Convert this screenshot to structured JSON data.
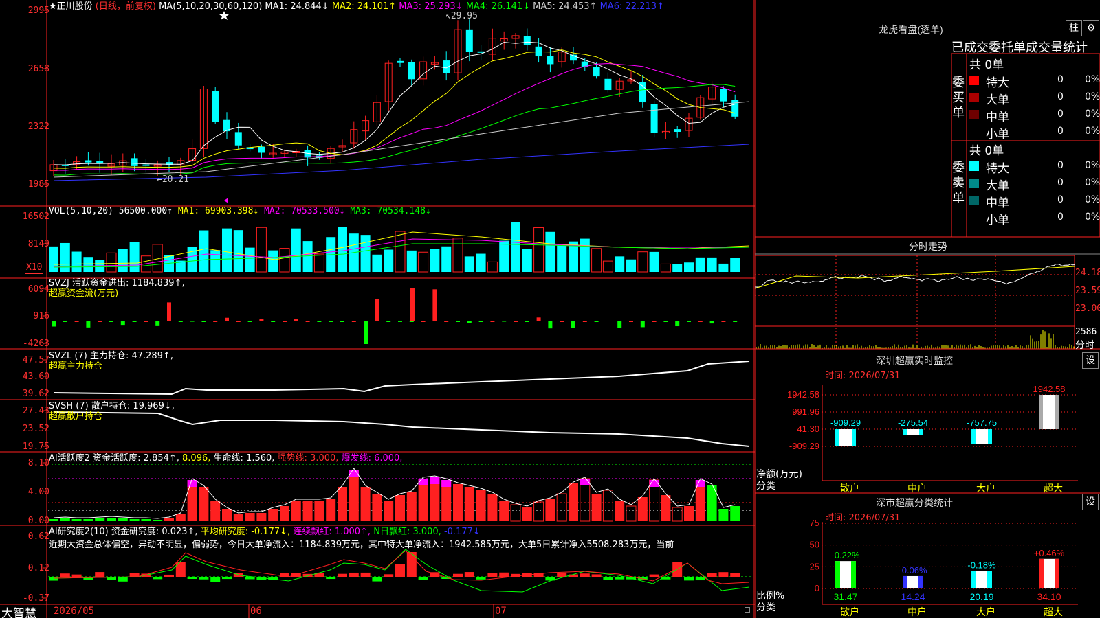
{
  "main": {
    "stock_name": "★正川股份",
    "period": "(日线，前复权)",
    "ma_params": "MA(5,10,20,30,60,120)",
    "ma": [
      {
        "label": "MA1:",
        "value": "24.844↓",
        "color": "#ffffff"
      },
      {
        "label": "MA2:",
        "value": "24.101↑",
        "color": "#ffff00"
      },
      {
        "label": "MA3:",
        "value": "25.293↓",
        "color": "#ff00ff"
      },
      {
        "label": "MA4:",
        "value": "26.141↓",
        "color": "#00ff00"
      },
      {
        "label": "MA5:",
        "value": "24.453↑",
        "color": "#cccccc"
      },
      {
        "label": "MA6:",
        "value": "22.213↑",
        "color": "#3333ff"
      }
    ],
    "axis": [
      "2995",
      "2658",
      "2322",
      "1985"
    ],
    "high_label": "29.95",
    "low_label": "20.21"
  },
  "vol": {
    "header": "VOL(5,10,20)",
    "value": "56500.000↑",
    "ma1": "MA1: 69903.398↓",
    "ma2": "MA2: 70533.500↓",
    "ma3": "MA3: 70534.148↓",
    "axis": [
      "16502",
      "8149"
    ],
    "unit": "X10"
  },
  "svzj": {
    "header": "SVZJ  活跃资金进出: 1184.839↑,",
    "sub": "超赢资金流(万元)",
    "axis": [
      "6094",
      "916",
      "-4263"
    ]
  },
  "svzl": {
    "header": "SVZL (7) 主力持仓: 47.289↑,",
    "sub": "超赢主力持仓",
    "axis": [
      "47.57",
      "43.60",
      "39.62"
    ]
  },
  "svsh": {
    "header": "SVSH (7) 散户持仓: 19.969↓,",
    "sub": "超赢散户持仓",
    "axis": [
      "27.43",
      "23.52",
      "19.75"
    ]
  },
  "ai_active": {
    "header_a": "AI活跃度2 资金活跃度: 2.854↑,",
    "header_b": "8.096,",
    "header_c": "生命线: 1.560,",
    "header_d": "强势线: 3.000,",
    "header_e": "爆发线: 6.000,",
    "axis": [
      "8.10",
      "4.00",
      "0.00"
    ]
  },
  "ai_research": {
    "header_a": "AI研究度2(10) 资金研究度: 0.023↑,",
    "header_b": "平均研究度: -0.177↓,",
    "header_c": "连续飘红: 1.000↑,",
    "header_d": "N日飘红: 3.000,",
    "header_e": "-0.177↓",
    "summary": "近期大资金总体偏空，异动不明显，偏弱势，今日大单净流入：1184.839万元，其中特大单净流入：1942.585万元，大单5日累计净入5508.283万元，当前",
    "axis": [
      "0.62",
      "0.12",
      "-0.37"
    ]
  },
  "dates": [
    "2026/05",
    "06",
    "07"
  ],
  "brand": "大智慧",
  "longhu": {
    "title": "龙虎看盘(逐单)",
    "btn_zhu": "柱",
    "btn_gear": "⚙",
    "tabs": "已成交委托单成交量统计",
    "buy_label": "委买单",
    "sell_label": "委卖单",
    "buy_total": "共 0单",
    "sell_total": "共 0单",
    "buy_rows": [
      {
        "name": "特大",
        "v1": "0",
        "v2": "0%",
        "color": "#ff0000"
      },
      {
        "name": "大单",
        "v1": "0",
        "v2": "0%",
        "color": "#aa0000"
      },
      {
        "name": "中单",
        "v1": "0",
        "v2": "0%",
        "color": "#6e0000"
      },
      {
        "name": "小单",
        "v1": "0",
        "v2": "0%",
        "color": "#000000"
      }
    ],
    "sell_rows": [
      {
        "name": "特大",
        "v1": "0",
        "v2": "0%",
        "color": "#00ffff"
      },
      {
        "name": "大单",
        "v1": "0",
        "v2": "0%",
        "color": "#008b8b"
      },
      {
        "name": "中单",
        "v1": "0",
        "v2": "0%",
        "color": "#006666"
      },
      {
        "name": "小单",
        "v1": "0",
        "v2": "0%",
        "color": "#000000"
      }
    ]
  },
  "intraday": {
    "title": "分时走势",
    "prices": [
      "24.18",
      "23.59",
      "23.00"
    ],
    "volume": "2586",
    "vol_label": "分时"
  },
  "monitor": {
    "title": "深圳超赢实时监控",
    "btn": "设",
    "time": "时间: 2026/07/31",
    "axis": [
      "1942.58",
      "991.96",
      "41.30",
      "-909.29"
    ],
    "ylabel_a": "净额(万元)",
    "ylabel_b": "分类",
    "categories": [
      "散户",
      "中户",
      "大户",
      "超大"
    ],
    "values": [
      -909.29,
      -275.54,
      -757.75,
      1942.58
    ],
    "value_labels": [
      "-909.29",
      "-275.54",
      "-757.75",
      "1942.58"
    ]
  },
  "classify": {
    "title": "深市超赢分类统计",
    "btn": "设",
    "time": "时间: 2026/07/31",
    "axis": [
      "75",
      "50",
      "25",
      "0"
    ],
    "ylabel_a": "比例%",
    "ylabel_b": "分类",
    "categories": [
      "散户",
      "中户",
      "大户",
      "超大"
    ],
    "values": [
      31.47,
      14.24,
      20.19,
      34.1
    ],
    "value_labels": [
      "31.47",
      "14.24",
      "20.19",
      "34.10"
    ],
    "change_labels": [
      "-0.22%",
      "-0.06%",
      "-0.18%",
      "+0.46%"
    ]
  },
  "chart_data": [
    {
      "type": "bar",
      "title": "深圳超赢实时监控",
      "ylabel": "净额(万元)",
      "categories": [
        "散户",
        "中户",
        "大户",
        "超大"
      ],
      "values": [
        -909.29,
        -275.54,
        -757.75,
        1942.58
      ],
      "ylim": [
        -909.29,
        1942.58
      ]
    },
    {
      "type": "bar",
      "title": "深市超赢分类统计",
      "ylabel": "比例%",
      "categories": [
        "散户",
        "中户",
        "大户",
        "超大"
      ],
      "values": [
        31.47,
        14.24,
        20.19,
        34.1
      ],
      "ylim": [
        0,
        75
      ]
    }
  ]
}
